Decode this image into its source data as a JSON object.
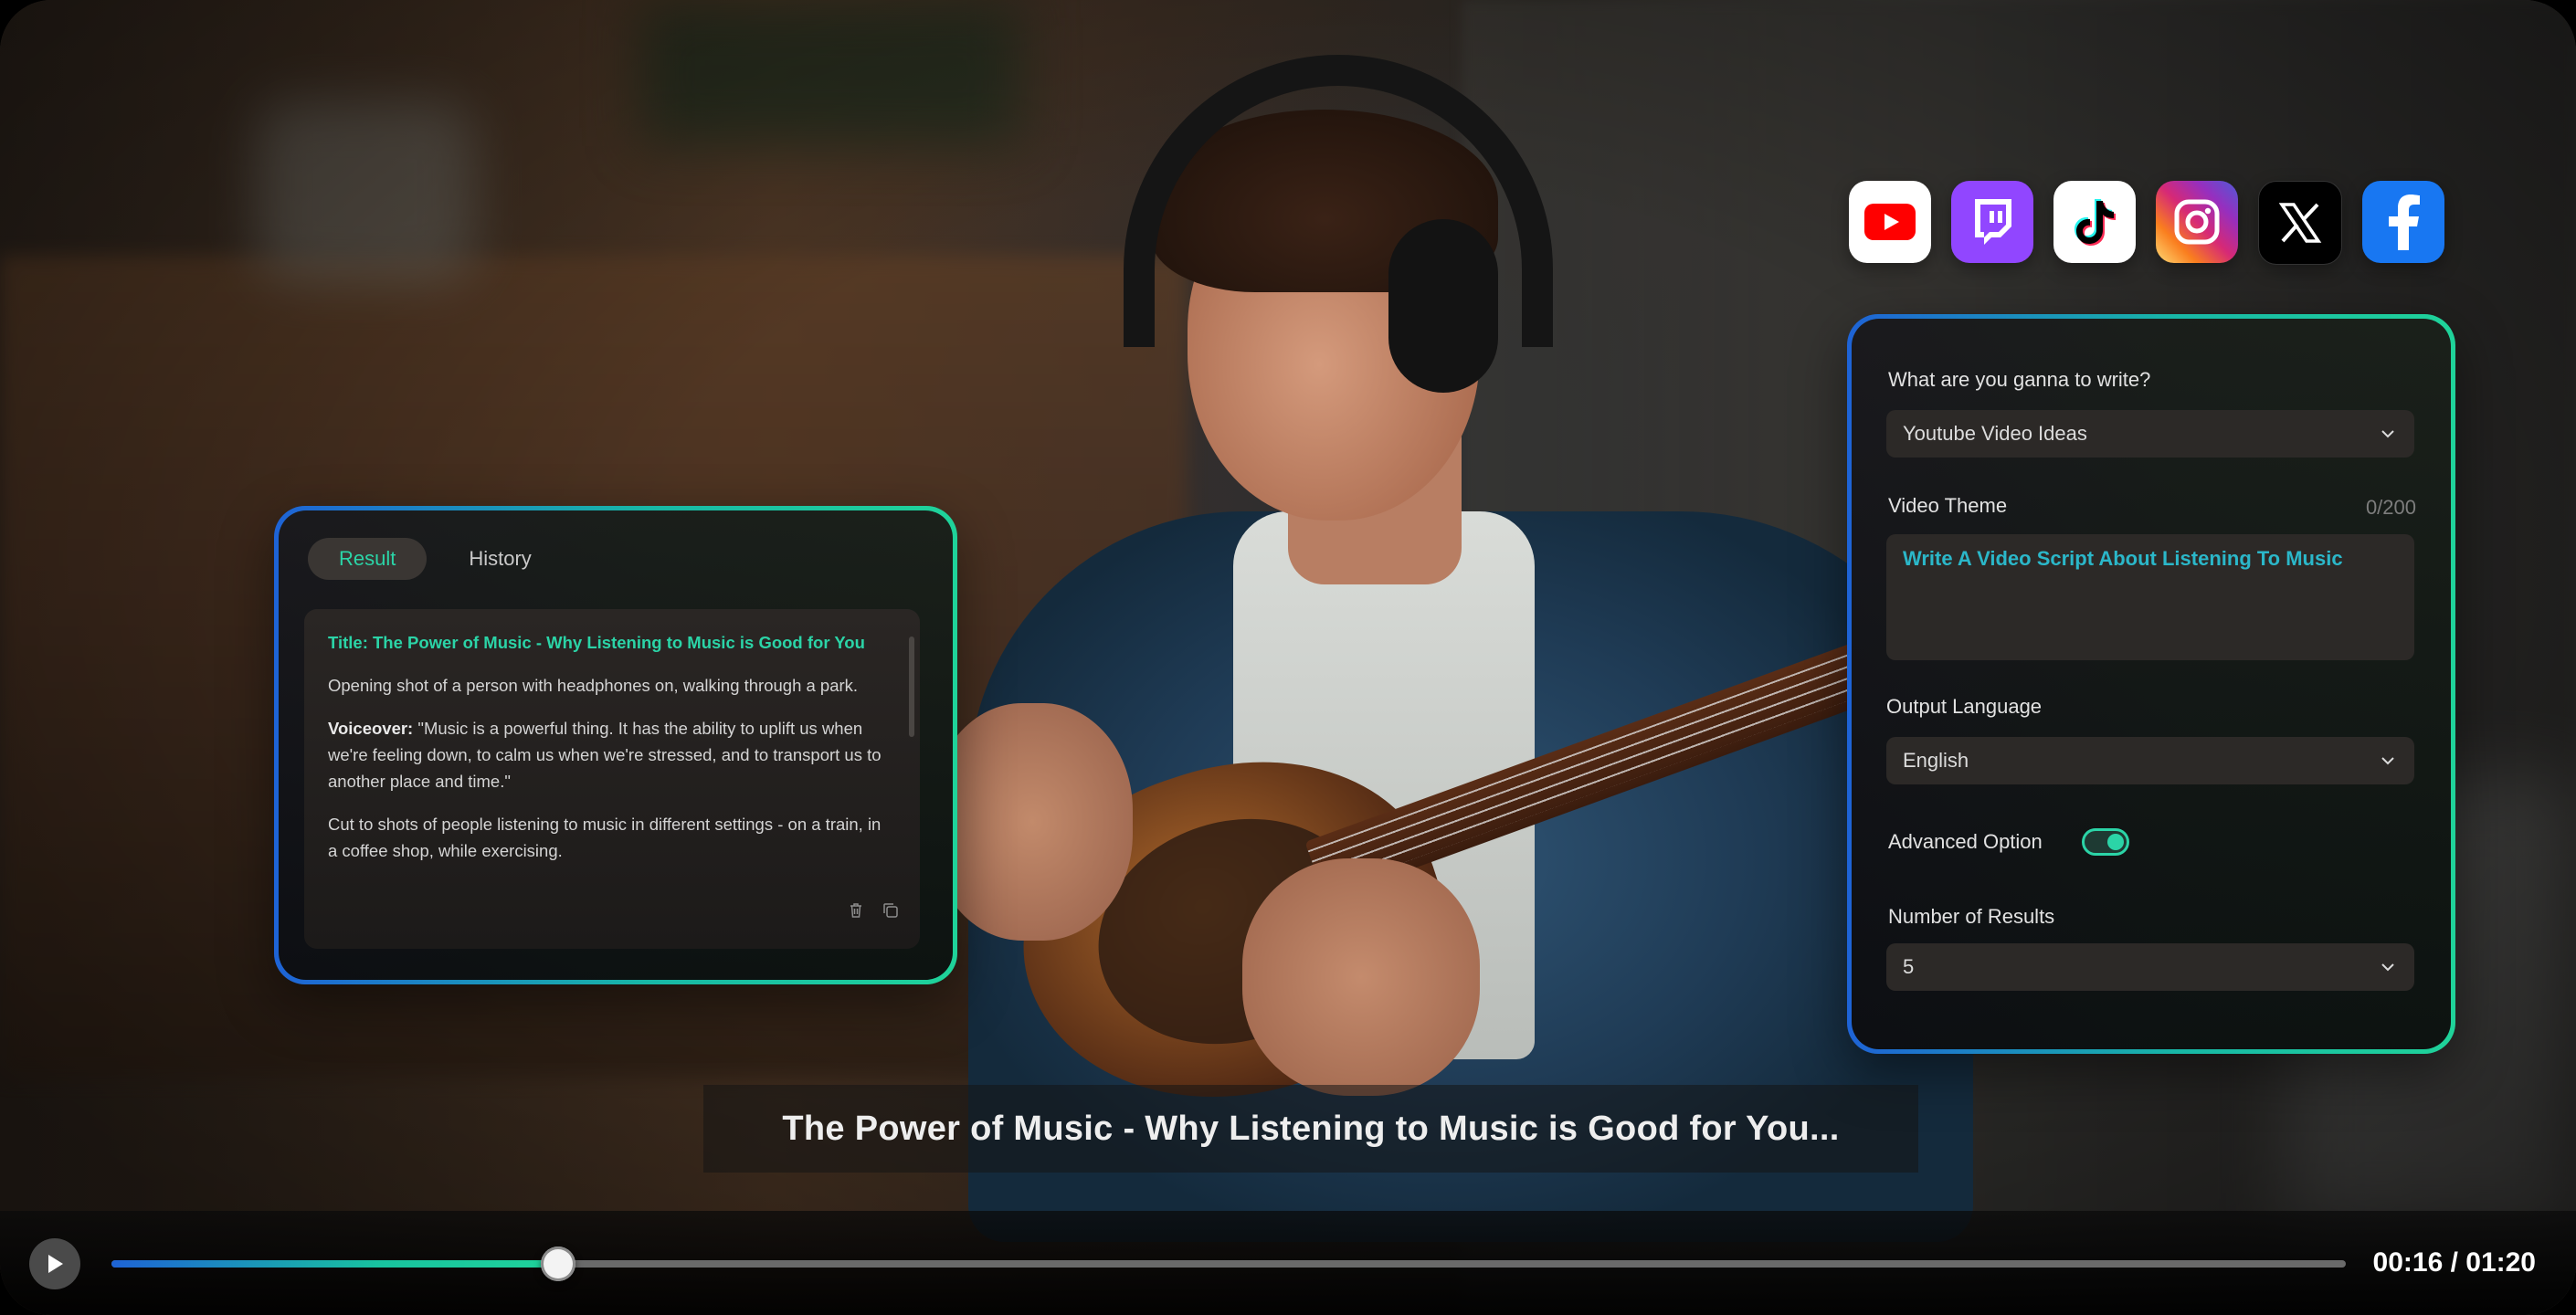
{
  "socials": [
    {
      "name": "YouTube",
      "icon": "youtube-icon"
    },
    {
      "name": "Twitch",
      "icon": "twitch-icon"
    },
    {
      "name": "TikTok",
      "icon": "tiktok-icon"
    },
    {
      "name": "Instagram",
      "icon": "instagram-icon"
    },
    {
      "name": "X",
      "icon": "x-icon"
    },
    {
      "name": "Facebook",
      "icon": "facebook-icon"
    }
  ],
  "result_panel": {
    "tabs": [
      {
        "label": "Result",
        "active": true
      },
      {
        "label": "History",
        "active": false
      }
    ],
    "title": "Title: The Power of Music - Why Listening to Music is Good for You",
    "para1": "Opening shot of a person with headphones on, walking through a park.",
    "voiceover_label": "Voiceover:",
    "voiceover_text": " \"Music is a powerful thing. It has the ability to uplift us when we're feeling down, to calm us when we're stressed, and to transport us to another place and time.\"",
    "para3": "Cut to shots of people listening to music in different settings - on a train, in a coffee shop, while exercising.",
    "actions": [
      "trash-icon",
      "copy-icon"
    ]
  },
  "form": {
    "write_label": "What are you ganna to write?",
    "write_value": "Youtube Video Ideas",
    "theme_label": "Video Theme",
    "theme_count": "0/200",
    "theme_value": "Write A Video Script About Listening To Music",
    "language_label": "Output Language",
    "language_value": "English",
    "advanced_label": "Advanced Option",
    "advanced_enabled": true,
    "results_label": "Number of Results",
    "results_value": "5"
  },
  "subtitle": "The Power of Music - Why Listening to Music is Good for You...",
  "player": {
    "progress": 0.2,
    "time": "00:16 / 01:20"
  },
  "colors": {
    "accent_teal": "#2bd4a7",
    "accent_blue": "#1e63d6",
    "accent_green": "#1fd39a"
  }
}
